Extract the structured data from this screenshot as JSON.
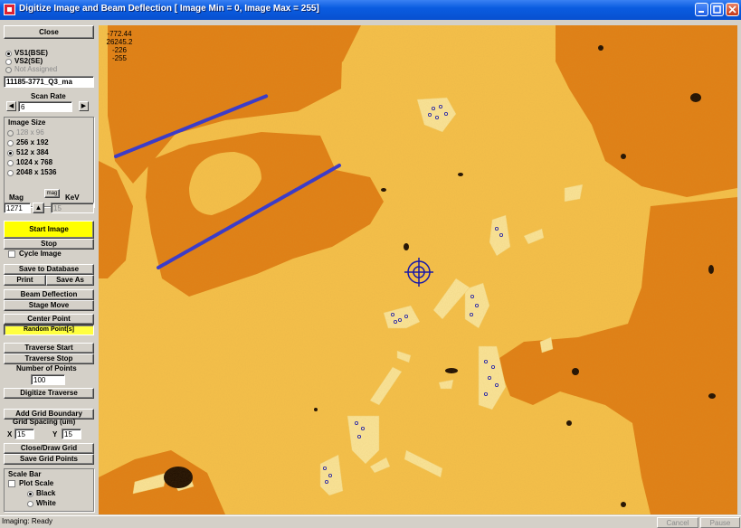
{
  "window": {
    "title": "Digitize Image and Beam Deflection [ Image Min = 0, Image Max = 255]"
  },
  "sidebar": {
    "close_label": "Close",
    "signal_options": [
      "VS1(BSE)",
      "VS2(SE)",
      "Not Assigned"
    ],
    "sample_name": "11185-3771_Q3_ma",
    "scan_rate_label": "Scan Rate",
    "scan_rate_value": "6",
    "image_size_label": "Image Size",
    "image_size_options": [
      "128 x 96",
      "256 x 192",
      "512 x 384",
      "1024 x 768",
      "2048 x 1536"
    ],
    "mag_label": "Mag",
    "mag_button_label": "mag",
    "kev_label": "KeV",
    "mag_value": "1271",
    "kev_value": "15",
    "start_image_label": "Start Image",
    "stop_label": "Stop",
    "cycle_image_label": "Cycle Image",
    "save_database_label": "Save to Database",
    "print_label": "Print",
    "save_as_label": "Save As",
    "beam_deflection_label": "Beam Deflection",
    "stage_move_label": "Stage Move",
    "center_point_label": "Center Point",
    "random_points_label": "Random Point[s]",
    "traverse_start_label": "Traverse Start",
    "traverse_stop_label": "Traverse Stop",
    "number_points_label": "Number of Points",
    "number_points_value": "100",
    "digitize_traverse_label": "Digitize Traverse",
    "add_grid_label": "Add Grid Boundary",
    "grid_spacing_label": "Grid Spacing (um)",
    "x_label": "X",
    "x_value": "15",
    "y_label": "Y",
    "y_value": "15",
    "close_draw_grid_label": "Close/Draw Grid",
    "save_grid_label": "Save Grid Points",
    "scale_bar_label": "Scale Bar",
    "plot_scale_label": "Plot Scale",
    "color_options": [
      "Black",
      "White"
    ]
  },
  "readout": {
    "line1": "-772.44",
    "line2": "26245.2",
    "line3": "-226",
    "line4": "-255"
  },
  "status": {
    "text": "Imaging: Ready",
    "cancel_label": "Cancel",
    "pause_label": "Pause"
  },
  "colors": {
    "bright_phase": "#f6c04a",
    "dark_phase": "#e17e14",
    "light_crystal": "#fbe59a",
    "traverse_line": "#3c3cc8",
    "crosshair": "#1a1aa8",
    "start_button": "#ffff00"
  }
}
